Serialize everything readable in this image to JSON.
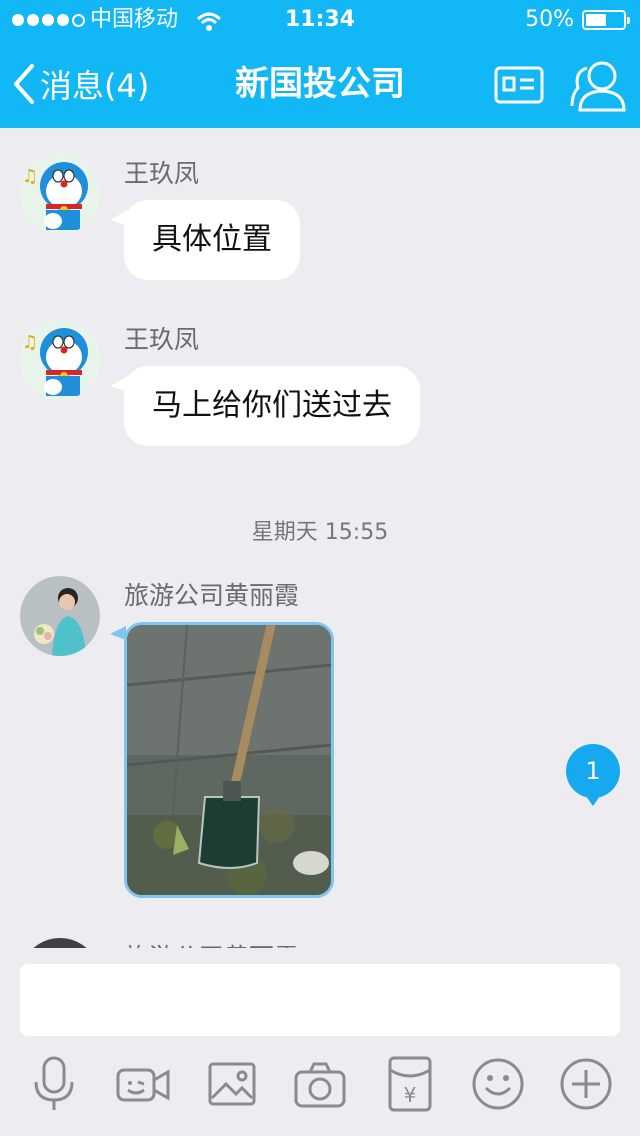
{
  "status_bar": {
    "carrier": "中国移动",
    "time": "11:34",
    "battery": "50%"
  },
  "header": {
    "back_label": "消息(4)",
    "title": "新国投公司",
    "profile_card_icon": "profile-card-icon",
    "group_members_icon": "group-members-icon"
  },
  "messages": [
    {
      "sender": "王玖凤",
      "text": "具体位置",
      "avatar": "doraemon-avatar"
    },
    {
      "sender": "王玖凤",
      "text": "马上给你们送过去",
      "avatar": "doraemon-avatar"
    },
    {
      "sender": "旅游公司黄丽霞",
      "type": "image",
      "avatar": "bride-avatar"
    }
  ],
  "timestamp": "星期天 15:55",
  "partial_sender": "旅游公司黄丽霞",
  "unread_badge": "1",
  "input": {
    "value": "",
    "placeholder": ""
  },
  "toolbar": [
    "mic-icon",
    "video-icon",
    "image-icon",
    "camera-icon",
    "red-packet-icon",
    "emoji-icon",
    "plus-icon"
  ],
  "colors": {
    "header": "#12b7f5",
    "badge": "#16a9ef",
    "background": "#ececf1"
  }
}
